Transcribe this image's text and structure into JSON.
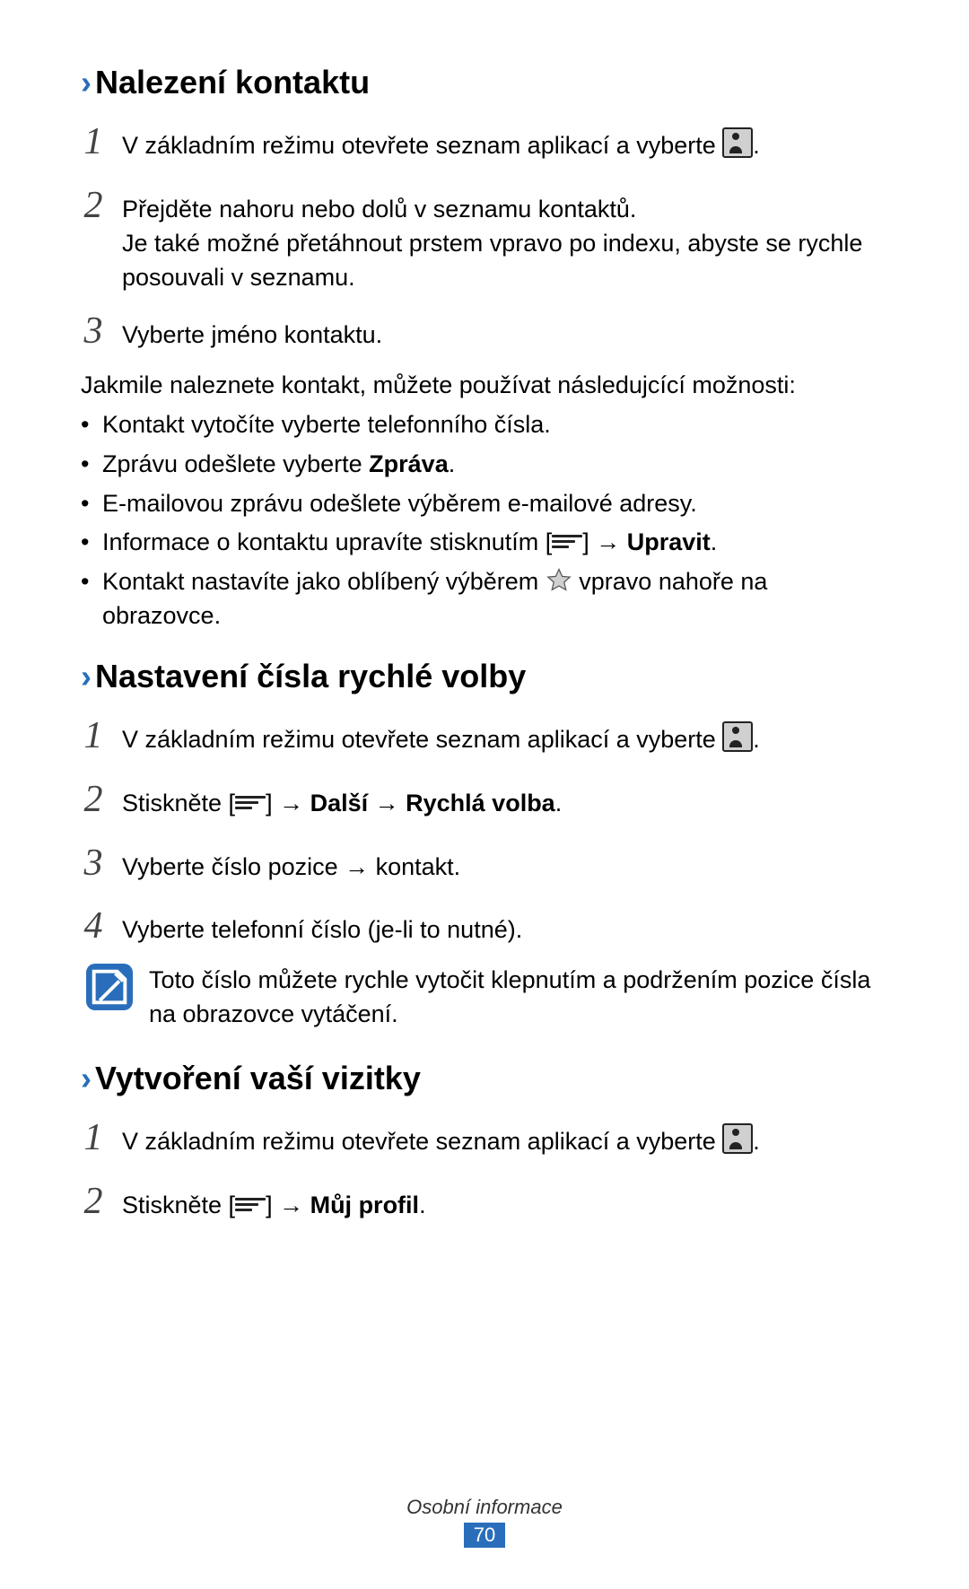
{
  "sections": {
    "s1": {
      "title": "Nalezení kontaktu",
      "steps": [
        {
          "n": "1",
          "pre": "V základním režimu otevřete seznam aplikací a vyberte ",
          "after_icon": "."
        },
        {
          "n": "2",
          "pre": "Přejděte nahoru nebo dolů v seznamu kontaktů.",
          "more": "Je také možné přetáhnout prstem vpravo po indexu, abyste se rychle posouvali v seznamu."
        },
        {
          "n": "3",
          "pre": "Vyberte jméno kontaktu."
        }
      ],
      "lead": "Jakmile naleznete kontakt, můžete používat následujcící možnosti:",
      "bullets": {
        "b1": {
          "text": "Kontakt vytočíte vyberte telefonního čísla."
        },
        "b2": {
          "pre": "Zprávu odešlete vyberte ",
          "bold": "Zpráva",
          "post": "."
        },
        "b3": {
          "text": "E-mailovou zprávu odešlete výběrem e-mailové adresy."
        },
        "b4": {
          "pre": "Informace o kontaktu upravíte stisknutím [",
          "mid": "] → ",
          "bold": "Upravit",
          "post": "."
        },
        "b5": {
          "pre": "Kontakt nastavíte jako oblíbený výběrem ",
          "post": " vpravo nahoře na obrazovce."
        }
      }
    },
    "s2": {
      "title": "Nastavení čísla rychlé volby",
      "steps": {
        "st1": {
          "n": "1",
          "pre": "V základním režimu otevřete seznam aplikací a vyberte ",
          "after_icon": "."
        },
        "st2": {
          "n": "2",
          "pre": "Stiskněte [",
          "mid": "] → ",
          "bold1": "Další",
          "mid2": " → ",
          "bold2": "Rychlá volba",
          "post": "."
        },
        "st3": {
          "n": "3",
          "pre": "Vyberte číslo pozice → kontakt."
        },
        "st4": {
          "n": "4",
          "pre": "Vyberte telefonní číslo (je-li to nutné)."
        }
      },
      "note": "Toto číslo můžete rychle vytočit klepnutím a podržením pozice čísla na obrazovce vytáčení."
    },
    "s3": {
      "title": "Vytvoření vaší vizitky",
      "steps": {
        "st1": {
          "n": "1",
          "pre": "V základním režimu otevřete seznam aplikací a vyberte ",
          "after_icon": "."
        },
        "st2": {
          "n": "2",
          "pre": "Stiskněte [",
          "mid": "] → ",
          "bold": "Můj profil",
          "post": "."
        }
      }
    }
  },
  "footer": {
    "section_label": "Osobní informace",
    "page_number": "70"
  }
}
